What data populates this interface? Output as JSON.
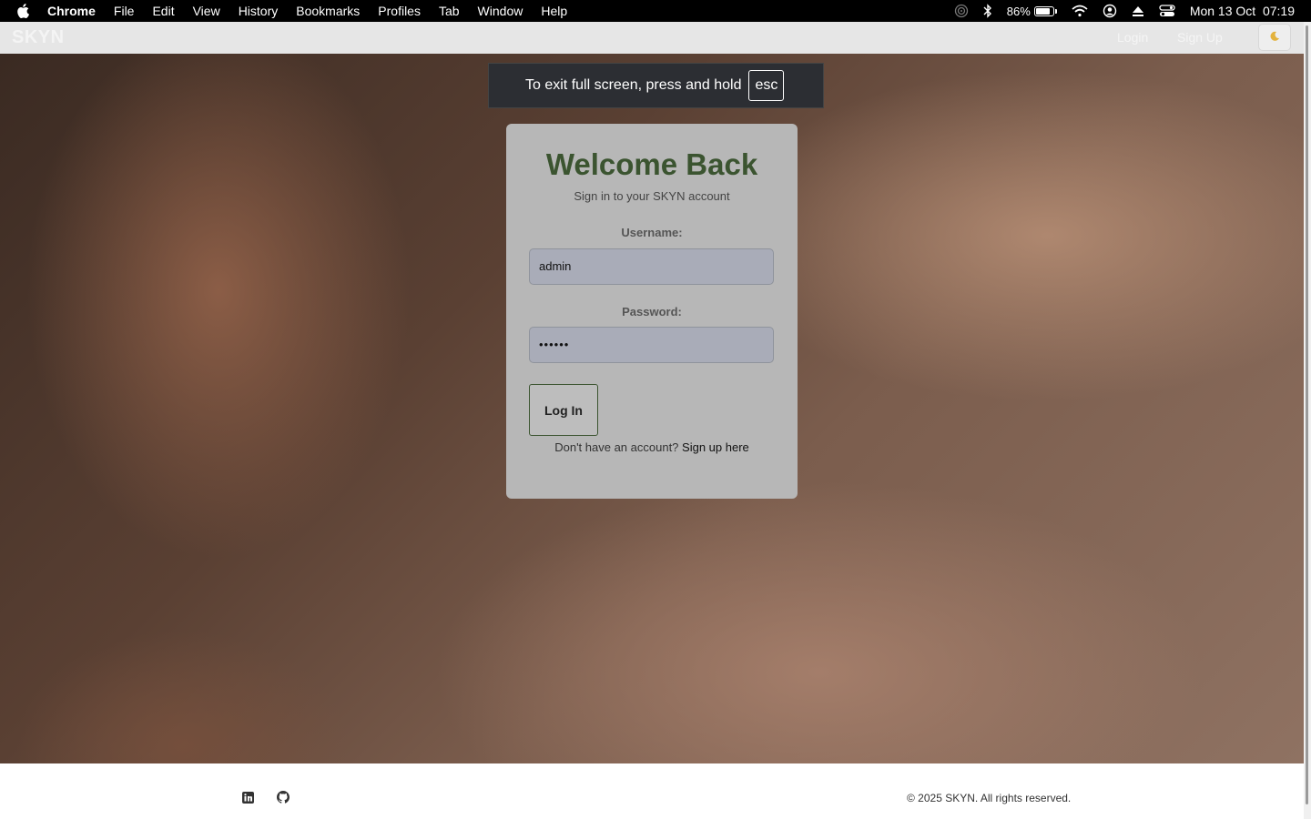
{
  "menubar": {
    "app": "Chrome",
    "items": [
      "File",
      "Edit",
      "View",
      "History",
      "Bookmarks",
      "Profiles",
      "Tab",
      "Window",
      "Help"
    ],
    "battery_percent": "86%",
    "battery_level": 0.86,
    "datetime": "Mon 13 Oct  07:19"
  },
  "nav": {
    "brand": "SKYN",
    "login": "Login",
    "signup": "Sign Up",
    "theme_icon": "moon-icon"
  },
  "fullscreen_notice": {
    "text": "To exit full screen, press and hold",
    "key": "esc"
  },
  "login": {
    "title": "Welcome Back",
    "subtitle": "Sign in to your SKYN account",
    "username_label": "Username:",
    "username_value": "admin",
    "password_label": "Password:",
    "password_value": "••••••",
    "button": "Log In",
    "signup_prompt": "Don't have an account?",
    "signup_link": "Sign up here"
  },
  "footer": {
    "copyright": "© 2025 SKYN. All rights reserved.",
    "icons": [
      "linkedin-icon",
      "github-icon"
    ]
  },
  "colors": {
    "title_green": "#3b5430",
    "card_bg": "#b7b7b7"
  }
}
